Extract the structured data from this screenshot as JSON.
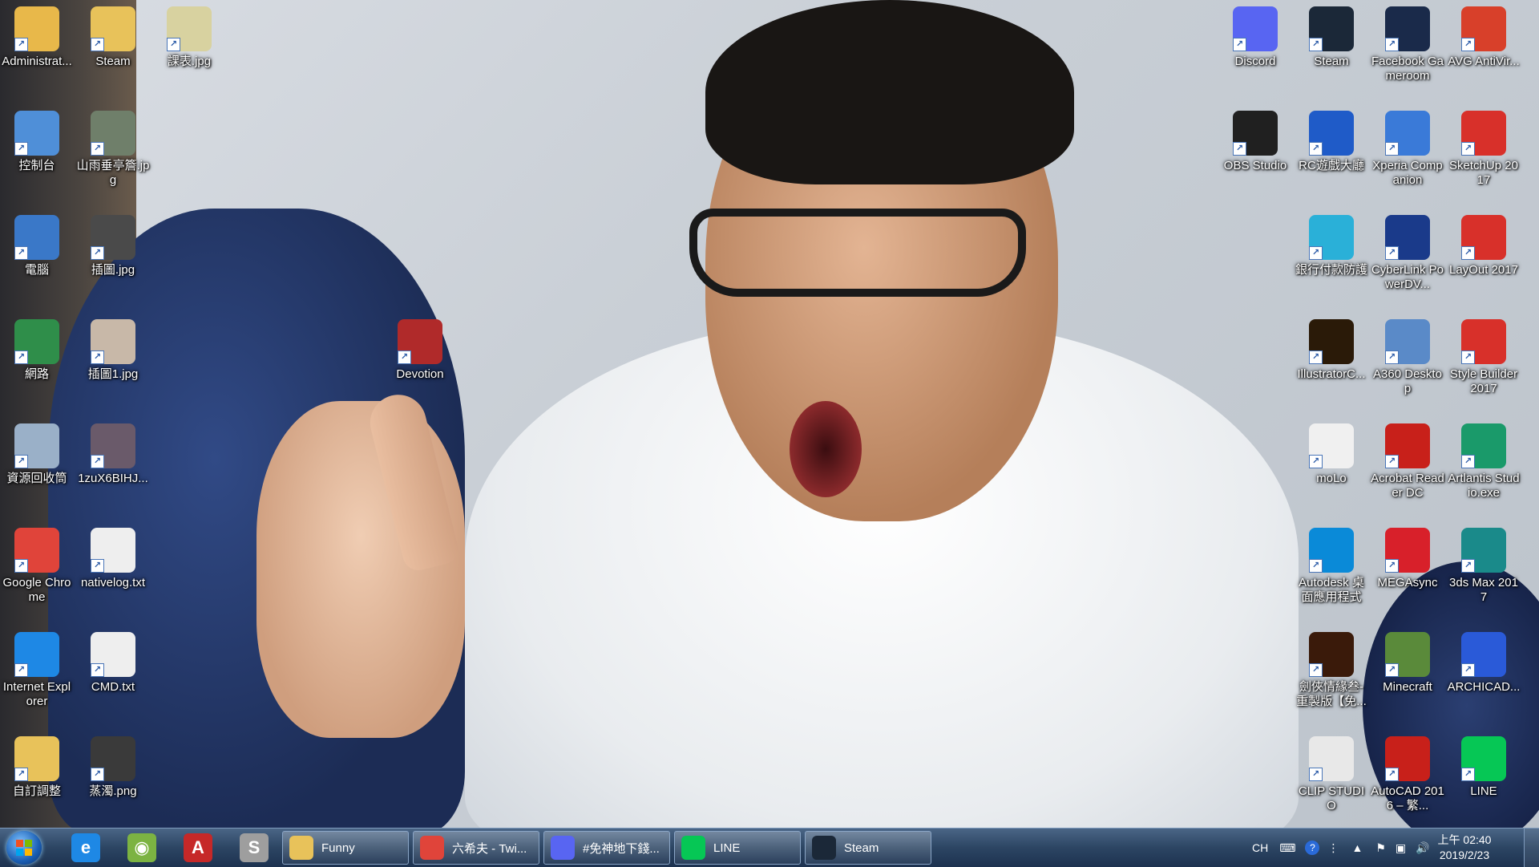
{
  "desktop": {
    "left_icons": [
      {
        "label": "Administrat...",
        "icon": "user-folder-icon",
        "color": "#e8b84a"
      },
      {
        "label": "Steam",
        "icon": "folder-icon",
        "color": "#e8c25a"
      },
      {
        "label": "課表.jpg",
        "icon": "image-file-icon",
        "color": "#d8d2a0"
      },
      {
        "label": "控制台",
        "icon": "control-panel-icon",
        "color": "#4f8fd8"
      },
      {
        "label": "山雨垂亭簷.jpg",
        "icon": "image-file-icon",
        "color": "#6f7f6a"
      },
      {
        "label": "電腦",
        "icon": "computer-icon",
        "color": "#3a78c8"
      },
      {
        "label": "插圖.jpg",
        "icon": "image-file-icon",
        "color": "#4a4a4a"
      },
      {
        "label": "網路",
        "icon": "network-icon",
        "color": "#2f8e4a"
      },
      {
        "label": "插圖1.jpg",
        "icon": "image-file-icon",
        "color": "#c8b8a8"
      },
      {
        "label": "Devotion",
        "icon": "game-devotion-icon",
        "color": "#b02a2a"
      },
      {
        "label": "資源回收筒",
        "icon": "recycle-bin-icon",
        "color": "#9ab0c8"
      },
      {
        "label": "1zuX6BIHJ...",
        "icon": "image-file-icon",
        "color": "#6a5a6a"
      },
      {
        "label": "Google Chrome",
        "icon": "chrome-icon",
        "color": "#e0443a"
      },
      {
        "label": "nativelog.txt",
        "icon": "text-file-icon",
        "color": "#eeeeee"
      },
      {
        "label": "Internet Explorer",
        "icon": "internet-explorer-icon",
        "color": "#1e88e5"
      },
      {
        "label": "CMD.txt",
        "icon": "text-file-icon",
        "color": "#eeeeee"
      },
      {
        "label": "自訂調整",
        "icon": "folder-icon",
        "color": "#e8c25a"
      },
      {
        "label": "蒸濁.png",
        "icon": "image-file-icon",
        "color": "#3a3a3a"
      }
    ],
    "right_icons": [
      {
        "label": "Discord",
        "icon": "discord-icon",
        "color": "#5865f2"
      },
      {
        "label": "Steam",
        "icon": "steam-icon",
        "color": "#1b2838"
      },
      {
        "label": "Facebook Gameroom",
        "icon": "facebook-gameroom-icon",
        "color": "#1a2a4a"
      },
      {
        "label": "AVG AntiVir...",
        "icon": "avg-antivirus-icon",
        "color": "#d8402a"
      },
      {
        "label": "OBS Studio",
        "icon": "obs-studio-icon",
        "color": "#202020"
      },
      {
        "label": "RC遊戲大廳",
        "icon": "rc-game-lobby-icon",
        "color": "#1f5bc8"
      },
      {
        "label": "Xperia Companion",
        "icon": "xperia-companion-icon",
        "color": "#3a7ad8"
      },
      {
        "label": "SketchUp 2017",
        "icon": "sketchup-icon",
        "color": "#d8302a"
      },
      {
        "label": "銀行付款防護",
        "icon": "bank-protection-icon",
        "color": "#2ab0d8"
      },
      {
        "label": "CyberLink PowerDV...",
        "icon": "powerdvd-icon",
        "color": "#1a3a8a"
      },
      {
        "label": "LayOut 2017",
        "icon": "layout-icon",
        "color": "#d8302a"
      },
      {
        "label": "IllustratorC...",
        "icon": "illustrator-icon",
        "color": "#2a1a08"
      },
      {
        "label": "A360 Desktop",
        "icon": "a360-icon",
        "color": "#5a8ac8"
      },
      {
        "label": "Style Builder 2017",
        "icon": "style-builder-icon",
        "color": "#d8302a"
      },
      {
        "label": "moLo",
        "icon": "molo-icon",
        "color": "#f0f0f0"
      },
      {
        "label": "Acrobat Reader DC",
        "icon": "acrobat-reader-icon",
        "color": "#c8201a"
      },
      {
        "label": "Artlantis Studio.exe",
        "icon": "artlantis-icon",
        "color": "#1a9a6a"
      },
      {
        "label": "Autodesk 桌面應用程式",
        "icon": "autodesk-icon",
        "color": "#0a8ad8"
      },
      {
        "label": "MEGAsync",
        "icon": "megasync-icon",
        "color": "#d8202a"
      },
      {
        "label": "3ds Max 2017",
        "icon": "3ds-max-icon",
        "color": "#1a8a8a"
      },
      {
        "label": "劍俠情緣叁-重製版【免...",
        "icon": "jx3-game-icon",
        "color": "#3a1a0a"
      },
      {
        "label": "Minecraft",
        "icon": "minecraft-icon",
        "color": "#5a8a3a"
      },
      {
        "label": "ARCHICAD...",
        "icon": "archicad-icon",
        "color": "#2a5ad8"
      },
      {
        "label": "CLIP STUDIO",
        "icon": "clip-studio-icon",
        "color": "#e8e8e8"
      },
      {
        "label": "AutoCAD 2016 – 繁...",
        "icon": "autocad-icon",
        "color": "#c8201a"
      },
      {
        "label": "LINE",
        "icon": "line-icon",
        "color": "#06c755"
      }
    ]
  },
  "taskbar": {
    "pinned": [
      {
        "name": "internet-explorer-icon",
        "glyph": "e",
        "color": "#1e88e5"
      },
      {
        "name": "map-app-icon",
        "glyph": "◉",
        "color": "#7cb342"
      },
      {
        "name": "autocad-icon",
        "glyph": "A",
        "color": "#c62828"
      },
      {
        "name": "clip-studio-icon",
        "glyph": "S",
        "color": "#9e9e9e"
      }
    ],
    "tasks": [
      {
        "label": "Funny",
        "icon": "folder-icon",
        "color": "#e8c25a"
      },
      {
        "label": "六希夫 - Twi...",
        "icon": "chrome-icon",
        "color": "#e0443a"
      },
      {
        "label": "#免神地下錢...",
        "icon": "discord-icon",
        "color": "#5865f2"
      },
      {
        "label": "LINE",
        "icon": "line-icon",
        "color": "#06c755"
      },
      {
        "label": "Steam",
        "icon": "steam-icon",
        "color": "#1b2838"
      }
    ],
    "tray": {
      "language": "CH",
      "time": "上午 02:40",
      "date": "2019/2/23"
    }
  }
}
